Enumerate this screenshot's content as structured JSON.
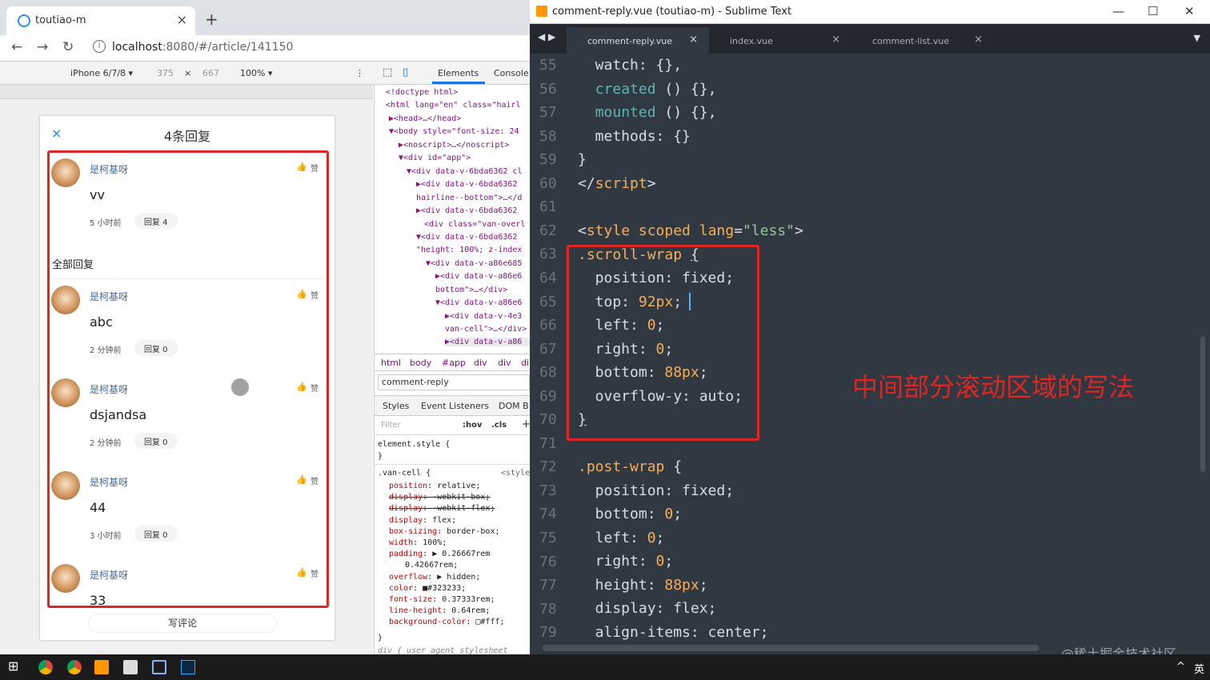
{
  "browser": {
    "tab_title": "toutiao-m",
    "tab_close": "×",
    "new_tab": "+",
    "url_host": "localhost",
    "url_rest": ":8080/#/article/141150",
    "device": "iPhone 6/7/8 ▾",
    "width": "375",
    "times": "×",
    "height": "667",
    "zoom": "100% ▾",
    "devtools_tabs": [
      "Elements",
      "Console"
    ]
  },
  "mobile": {
    "close": "×",
    "title": "4条回复",
    "all_replies": "全部回复",
    "write_comment": "写评论",
    "comments": [
      {
        "name": "是柯基呀",
        "content": "vv",
        "time": "5 小时前",
        "reply": "回复 4"
      },
      {
        "name": "是柯基呀",
        "content": "abc",
        "time": "2 分钟前",
        "reply": "回复 0"
      },
      {
        "name": "是柯基呀",
        "content": "dsjandsa",
        "time": "2 分钟前",
        "reply": "回复 0"
      },
      {
        "name": "是柯基呀",
        "content": "44",
        "time": "3 小时前",
        "reply": "回复 0"
      },
      {
        "name": "是柯基呀",
        "content": "33",
        "time": "",
        "reply": ""
      }
    ],
    "like_icon": "👍",
    "like_label": "赞"
  },
  "devtools": {
    "dom_lines": [
      "<!doctype html>",
      "<html lang=\"en\" class=\"hairl",
      "▶<head>…</head>",
      "▼<body style=\"font-size: 24",
      "▶<noscript>…</noscript>",
      "▼<div id=\"app\">",
      "▼<div data-v-6bda6362 cl",
      "▶<div data-v-6bda6362",
      "hairline--bottom\">…</d",
      "▶<div data-v-6bda6362",
      "<div class=\"van-overl",
      "▼<div data-v-6bda6362",
      "\"height: 100%; z-index",
      "▼<div data-v-a86e685",
      "▶<div data-v-a86e6",
      "bottom\">…</div>",
      "▼<div data-v-a86e6",
      "▶<div data-v-4e3",
      "van-cell\">…</div>",
      "▶<div data-v-a86"
    ],
    "breadcrumbs": [
      "html",
      "body",
      "#app",
      "div",
      "div",
      "di"
    ],
    "selected_node": "comment-reply",
    "style_tabs": [
      "Styles",
      "Event Listeners",
      "DOM B"
    ],
    "filter_placeholder": "Filter",
    "hov": ":hov",
    "cls": ".cls",
    "plus": "+",
    "element_style": "element.style {",
    "close_brace": "}",
    "rule_selector": ".van-cell {",
    "rule_source": "<style",
    "props": [
      {
        "name": "position",
        "value": "relative;",
        "strike": false
      },
      {
        "name": "display",
        "value": "-webkit-box;",
        "strike": true
      },
      {
        "name": "display",
        "value": "-webkit-flex;",
        "strike": true
      },
      {
        "name": "display",
        "value": "flex;",
        "strike": false
      },
      {
        "name": "box-sizing",
        "value": "border-box;",
        "strike": false
      },
      {
        "name": "width",
        "value": "100%;",
        "strike": false
      },
      {
        "name": "padding",
        "value": "▶ 0.26667rem",
        "strike": false
      },
      {
        "name": "",
        "value": "0.42667rem;",
        "strike": false
      },
      {
        "name": "overflow",
        "value": "▶ hidden;",
        "strike": false
      },
      {
        "name": "color",
        "value": "■#323233;",
        "strike": false
      },
      {
        "name": "font-size",
        "value": "0.37333rem;",
        "strike": false
      },
      {
        "name": "line-height",
        "value": "0.64rem;",
        "strike": false
      },
      {
        "name": "background-color",
        "value": "□#fff;",
        "strike": false
      }
    ],
    "ua_line": "div {      user agent stylesheet"
  },
  "sublime": {
    "window_title": "comment-reply.vue (toutiao-m) - Sublime Text",
    "tabs": [
      {
        "name": "comment-reply.vue",
        "close": "×"
      },
      {
        "name": "index.vue",
        "close": "×"
      },
      {
        "name": "comment-list.vue",
        "close": "×"
      }
    ],
    "line_numbers": [
      "55",
      "56",
      "57",
      "58",
      "59",
      "60",
      "61",
      "62",
      "63",
      "64",
      "65",
      "66",
      "67",
      "68",
      "69",
      "70",
      "71",
      "72",
      "73",
      "74",
      "75",
      "76",
      "77",
      "78",
      "79"
    ],
    "annotation": "中间部分滚动区域的写法",
    "watermark": "@稀土掘金技术社区"
  },
  "taskbar": {
    "lang": "英",
    "caret": "^"
  },
  "colors": {
    "red_box": "#e02525",
    "editor_bg": "#303841",
    "link": "#466b9d"
  }
}
